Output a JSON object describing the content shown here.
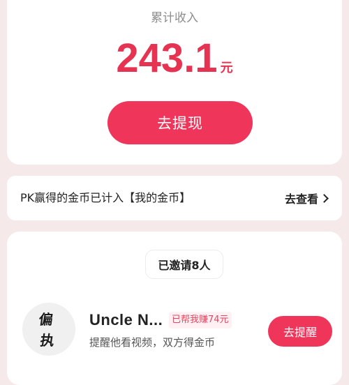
{
  "income": {
    "label": "累计收入",
    "amount": "243.1",
    "unit": "元",
    "withdraw_label": "去提现"
  },
  "notice": {
    "text": "PK赢得的金币已计入【我的金币】",
    "link_label": "去查看"
  },
  "invite": {
    "invited_label": "已邀请8人",
    "users": [
      {
        "avatar_text_1": "偏",
        "avatar_text_2": "执",
        "name": "Uncle N...",
        "earned": "已帮我赚74元",
        "desc": "提醒他看视频，双方得金币",
        "action_label": "去提醒"
      }
    ]
  },
  "colors": {
    "accent": "#f0355a",
    "amount": "#e63352",
    "background": "#f6e9ea"
  }
}
